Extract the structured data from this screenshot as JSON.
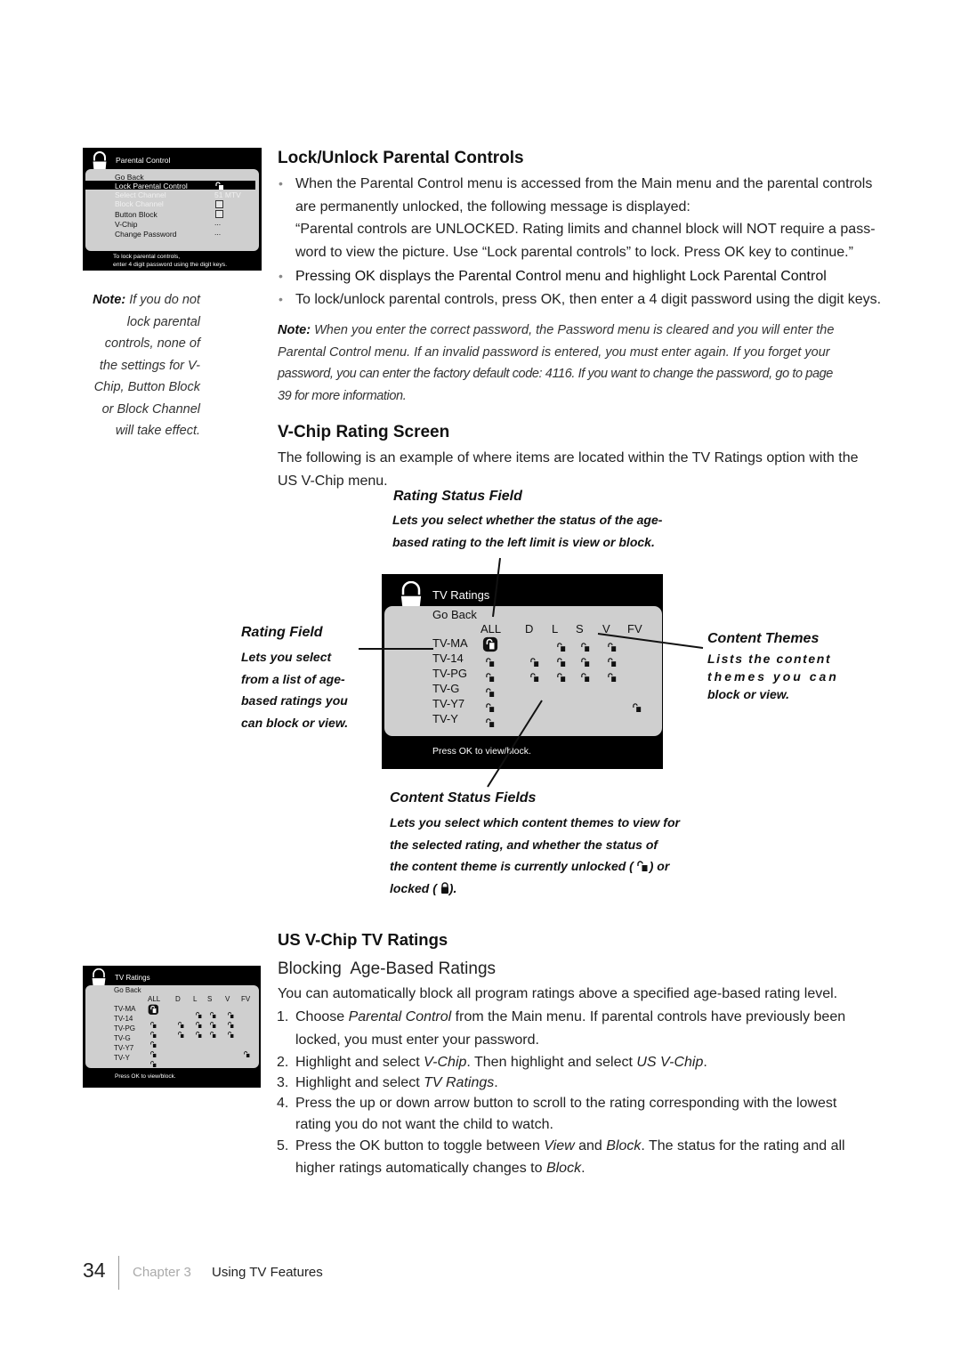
{
  "parental_panel": {
    "title": "Parental Control",
    "items": [
      {
        "label": "Go Back",
        "value": "",
        "state": "normal"
      },
      {
        "label": "Lock Parental Control",
        "value": "unlocked-icon",
        "state": "highlighted"
      },
      {
        "label": "Select Channel",
        "value": "51 MTV",
        "state": "dimmed"
      },
      {
        "label": "Block Channel",
        "value": "checkbox",
        "state": "dimmed"
      },
      {
        "label": "Button Block",
        "value": "checkbox",
        "state": "normal"
      },
      {
        "label": "V-Chip",
        "value": "...",
        "state": "normal"
      },
      {
        "label": "Change Password",
        "value": "...",
        "state": "normal"
      }
    ],
    "footer_line1": "To lock parental controls,",
    "footer_line2": "enter 4 digit password using the digit keys."
  },
  "side_note": {
    "label": "Note:",
    "text": "If you do not lock parental controls, none of the settings for V-Chip, Button Block or Block Channel will take effect."
  },
  "section1": {
    "heading": "Lock/Unlock Parental Controls",
    "bullet1_line1": "When the Parental Control menu is accessed from the Main menu and the parental controls",
    "bullet1_line2": "are permanently unlocked, the following message is displayed:",
    "quote_line1": "“Parental controls are UNLOCKED. Rating limits and channel block will NOT require a pass-",
    "quote_line2": "word to view the picture. Use “Lock parental controls” to lock. Press OK key to continue.”",
    "bullet2": "Pressing OK displays the Parental Control menu and highlight Lock Parental Control",
    "bullet3": "To lock/unlock parental controls, press OK, then enter a 4 digit password using the digit keys.",
    "note_label": "Note:",
    "note_line1": "When you enter the correct password, the Password menu is cleared and you will enter the",
    "note_line2": "Parental Control menu. If an invalid password is entered, you must enter again. If you forget your",
    "note_line3": "password, you can enter the factory default code: 4116. If you want to change the password, go to page",
    "note_line4": "39 for more information."
  },
  "section2": {
    "heading": "V-Chip Rating Screen",
    "intro_line1": "The following is an example of where items are located within the TV Ratings option with the",
    "intro_line2": "US V-Chip menu.",
    "callouts": {
      "rating_status": {
        "title": "Rating Status Field",
        "line1": "Lets you select whether the status of the age-",
        "line2": "based rating to the left limit is view or block."
      },
      "rating_field": {
        "title": "Rating Field",
        "line1": "Lets you select",
        "line2": "from a list of age-",
        "line3": "based ratings you",
        "line4": "can block or view."
      },
      "content_themes": {
        "title": "Content Themes",
        "line1": "Lists the content",
        "line2": "themes you can",
        "line3": "block or view."
      },
      "content_status": {
        "title": "Content Status Fields",
        "line1": "Lets you select which content themes to view for",
        "line2": "the selected rating, and whether the status of",
        "line3a": "the content theme is currently unlocked (",
        "line3b": ") or",
        "line4a": "locked (",
        "line4b": ")."
      }
    }
  },
  "tv_ratings_panel": {
    "title": "TV Ratings",
    "go_back": "Go Back",
    "columns": [
      "ALL",
      "D",
      "L",
      "S",
      "V",
      "FV"
    ],
    "rows": [
      {
        "rating": "TV-MA",
        "cells": [
          "selected-unlocked",
          "",
          "unlocked",
          "unlocked",
          "unlocked",
          ""
        ]
      },
      {
        "rating": "TV-14",
        "cells": [
          "unlocked",
          "unlocked",
          "unlocked",
          "unlocked",
          "unlocked",
          ""
        ]
      },
      {
        "rating": "TV-PG",
        "cells": [
          "unlocked",
          "unlocked",
          "unlocked",
          "unlocked",
          "unlocked",
          ""
        ]
      },
      {
        "rating": "TV-G",
        "cells": [
          "unlocked",
          "",
          "",
          "",
          "",
          ""
        ]
      },
      {
        "rating": "TV-Y7",
        "cells": [
          "unlocked",
          "",
          "",
          "",
          "",
          "unlocked"
        ]
      },
      {
        "rating": "TV-Y",
        "cells": [
          "unlocked",
          "",
          "",
          "",
          "",
          ""
        ]
      }
    ],
    "footer": "Press OK to view/block."
  },
  "section3": {
    "heading": "US V-Chip TV Ratings",
    "subheading": "Blocking  Age-Based Ratings",
    "intro": "You can automatically block all program ratings above a specified age-based rating level.",
    "steps": [
      {
        "num": "1.",
        "a": "Choose ",
        "i": "Parental Control",
        "b": " from the Main menu. If parental controls have previously been",
        "line2": "locked, you must enter your password."
      },
      {
        "num": "2.",
        "a": "Highlight and select ",
        "i": "V-Chip",
        "b": ". Then highlight and select ",
        "i2": "US V-Chip",
        "c": "."
      },
      {
        "num": "3.",
        "a": "Highlight and select ",
        "i": "TV Ratings",
        "b": "."
      },
      {
        "num": "4.",
        "a": "Press the up or down arrow button to scroll to the rating corresponding with the lowest",
        "line2": "rating you do not want the child to watch."
      },
      {
        "num": "5.",
        "a": "Press the OK button to toggle between ",
        "i": "View",
        "b": " and ",
        "i2": "Block",
        "c": ". The status for the rating and all",
        "line2a": "higher ratings automatically changes to ",
        "line2i": "Block",
        "line2b": "."
      }
    ]
  },
  "page_footer": {
    "page_number": "34",
    "chapter": "Chapter 3",
    "title": "Using TV Features"
  }
}
